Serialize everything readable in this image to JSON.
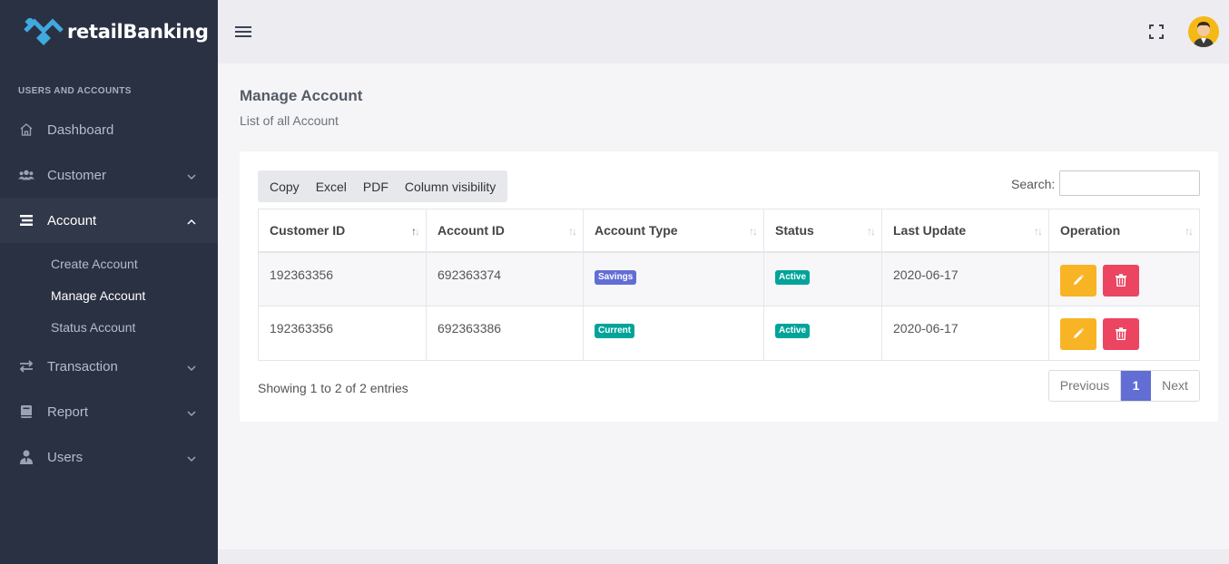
{
  "brand": {
    "name": "retailBanking"
  },
  "colors": {
    "sidebar": "#2a3142",
    "accent": "#626ed4",
    "teal": "#02a499",
    "edit": "#f8b425",
    "delete": "#ec4561"
  },
  "sidebar": {
    "section_title": "USERS AND ACCOUNTS",
    "items": [
      {
        "label": "Dashboard",
        "icon": "home-icon"
      },
      {
        "label": "Customer",
        "icon": "users-icon"
      },
      {
        "label": "Account",
        "icon": "list-icon"
      },
      {
        "label": "Transaction",
        "icon": "transfer-icon"
      },
      {
        "label": "Report",
        "icon": "book-icon"
      },
      {
        "label": "Users",
        "icon": "user-tie-icon"
      }
    ],
    "account_submenu": [
      "Create Account",
      "Manage Account",
      "Status Account"
    ]
  },
  "page": {
    "title": "Manage Account",
    "subtitle": "List of all Account"
  },
  "toolbar": {
    "copy": "Copy",
    "excel": "Excel",
    "pdf": "PDF",
    "column_visibility": "Column visibility"
  },
  "search": {
    "label": "Search:",
    "value": ""
  },
  "table": {
    "columns": [
      "Customer ID",
      "Account ID",
      "Account Type",
      "Status",
      "Last Update",
      "Operation"
    ],
    "rows": [
      {
        "customer_id": "192363356",
        "account_id": "692363374",
        "account_type": "Savings",
        "status": "Active",
        "last_update": "2020-06-17"
      },
      {
        "customer_id": "192363356",
        "account_id": "692363386",
        "account_type": "Current",
        "status": "Active",
        "last_update": "2020-06-17"
      }
    ]
  },
  "info": "Showing 1 to 2 of 2 entries",
  "pagination": {
    "previous": "Previous",
    "current": "1",
    "next": "Next"
  }
}
